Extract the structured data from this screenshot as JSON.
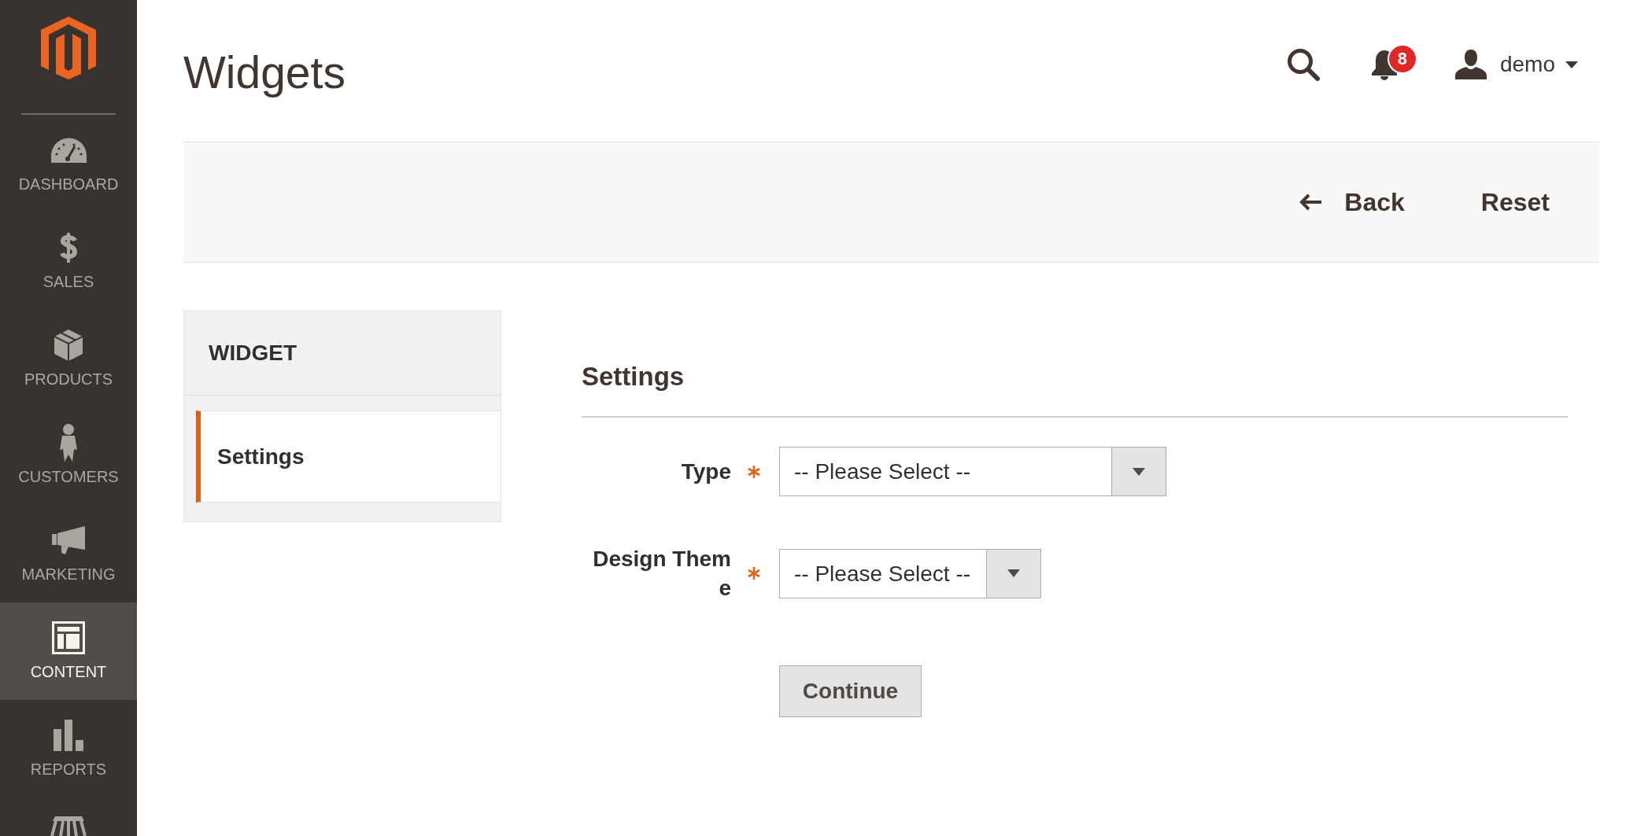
{
  "sidebar": {
    "items": [
      {
        "kind": "dashboard",
        "label": "DASHBOARD",
        "selected": false
      },
      {
        "kind": "sales",
        "label": "SALES",
        "selected": false
      },
      {
        "kind": "products",
        "label": "PRODUCTS",
        "selected": false
      },
      {
        "kind": "customers",
        "label": "CUSTOMERS",
        "selected": false
      },
      {
        "kind": "marketing",
        "label": "MARKETING",
        "selected": false
      },
      {
        "kind": "content",
        "label": "CONTENT",
        "selected": true
      },
      {
        "kind": "reports",
        "label": "REPORTS",
        "selected": false
      },
      {
        "kind": "stores",
        "selected": false
      }
    ]
  },
  "header": {
    "title": "Widgets",
    "notifications": {
      "count": "8"
    },
    "user": {
      "name": "demo"
    }
  },
  "page_actions": {
    "buttons": [
      {
        "kind": "back",
        "label": "Back"
      },
      {
        "kind": "reset",
        "label": "Reset"
      }
    ]
  },
  "nav": {
    "title": "WIDGET",
    "items": [
      {
        "label": "Settings",
        "selected": true
      }
    ]
  },
  "form": {
    "legend": "Settings",
    "fields": [
      {
        "label": "Type",
        "required": true,
        "value": "-- Please Select --"
      },
      {
        "label": "Design Theme",
        "required": true,
        "value": "-- Please Select --"
      }
    ],
    "submit": {
      "label": "Continue"
    }
  }
}
